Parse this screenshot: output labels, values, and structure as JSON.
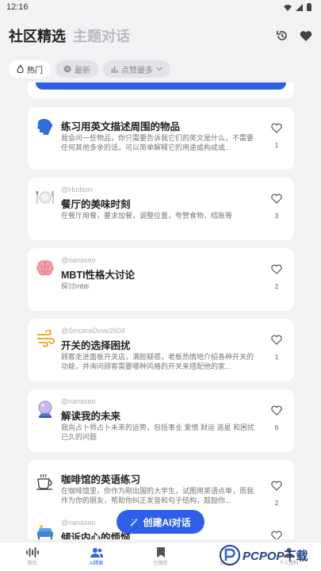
{
  "status_bar": {
    "time": "12:16"
  },
  "header": {
    "tab_community": "社区精选",
    "tab_topic": "主题对话"
  },
  "filters": [
    {
      "label": "热门",
      "icon": "fire-icon",
      "active": true
    },
    {
      "label": "最新",
      "icon": "clock-icon",
      "active": false
    },
    {
      "label": "点赞最多",
      "icon": "bar-chart-icon",
      "active": false
    }
  ],
  "cards": [
    {
      "author": "",
      "title": "练习用英文描述周围的物品",
      "desc": "我会问一些物品，你只需要告诉我它们的英文是什么，不需要任何其他多余的话，可以简单解释它的用途或构成或...",
      "likes": "1",
      "icon": "speaking-head-icon"
    },
    {
      "author": "@Hudson",
      "title": "餐厅的美味时刻",
      "desc": "在餐厅用餐，要求加餐，调整位置，夸赞食物，结账等",
      "likes": "3",
      "icon": "plate-cutlery-icon"
    },
    {
      "author": "@nanaseo",
      "title": "MBTI性格大讨论",
      "desc": "探讨mbti",
      "likes": "2",
      "icon": "brain-icon"
    },
    {
      "author": "@SincereDove2604",
      "title": "开关的选择困扰",
      "desc": "顾客走进面板开关店，满脸疑惑，老板热情地介绍各种开关的功能，并询问顾客需要哪种风格的开关来搭配他的家...",
      "likes": "1",
      "icon": "wind-swirl-icon"
    },
    {
      "author": "@nanaseo",
      "title": "解读我的未来",
      "desc": "我向占卜师占卜未来的运势，包括事业 爱情 财运 追星 和困扰已久的问题",
      "likes": "6",
      "icon": "crystal-ball-icon"
    },
    {
      "author": "",
      "title": "咖啡馆的英语练习",
      "desc": "在咖啡馆里，你作为刚出国的大学生，试图用英语点单，而我作为你的朋友，帮助你纠正发音和句子结构，鼓励你...",
      "likes": "2",
      "icon": "coffee-cup-icon"
    },
    {
      "author": "@nanaseo",
      "title": "倾诉内心的烦恼",
      "desc": "",
      "likes": "",
      "icon": "sofa-icon"
    }
  ],
  "fab": {
    "label": "创建AI对话"
  },
  "bottom_nav": [
    {
      "label": "首页",
      "icon": "waveform-icon",
      "active": false
    },
    {
      "label": "AI精聊",
      "icon": "people-icon",
      "active": true
    },
    {
      "label": "已保存",
      "icon": "bookmark-icon",
      "active": false
    },
    {
      "label": "我的",
      "icon": "home-icon",
      "active": false
    },
    {
      "label": "个人资料",
      "icon": "profile-icon",
      "active": false
    }
  ],
  "watermark": {
    "brand": "PCPOP",
    "suffix": "下载"
  },
  "colors": {
    "accent": "#2e5fe8",
    "background": "#f2f2f4",
    "card": "#ffffff"
  }
}
